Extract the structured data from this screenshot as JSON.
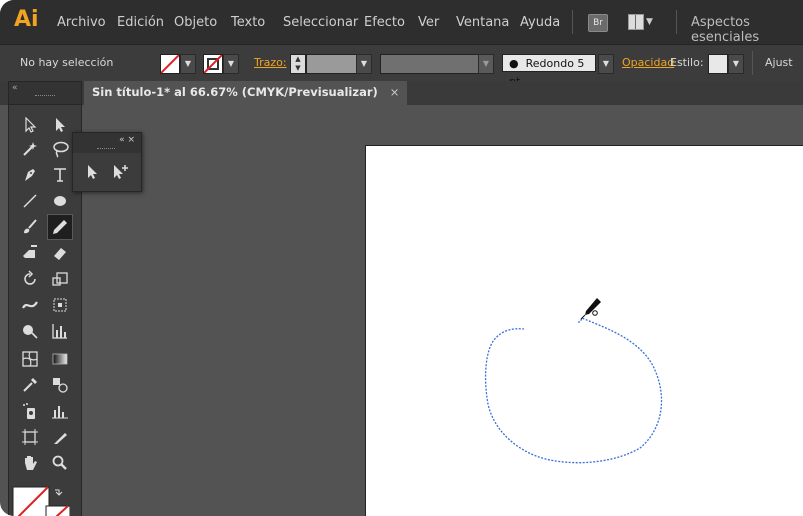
{
  "menubar": {
    "logo": "Ai",
    "items": [
      "Archivo",
      "Edición",
      "Objeto",
      "Texto",
      "Seleccionar",
      "Efecto",
      "Ver",
      "Ventana",
      "Ayuda"
    ],
    "bridge_label": "Br",
    "workspace": "Aspectos esenciales"
  },
  "controlbar": {
    "selection_status": "No hay selección",
    "stroke_label": "Trazo:",
    "brush": "Redondo 5 pt.",
    "opacity_label": "Opacidad",
    "style_label": "Estilo:",
    "adjust_label": "Ajust"
  },
  "document": {
    "tab_title": "Sin título-1* al 66.67% (CMYK/Previsualizar)",
    "close_glyph": "×"
  },
  "tools_panel": {
    "collapse_glyph": "«"
  },
  "flyout": {
    "controls": "«  ×"
  },
  "colors": {
    "accent": "#f0a522",
    "path_stroke": "#3a6fd8",
    "app_bg": "#535353"
  }
}
